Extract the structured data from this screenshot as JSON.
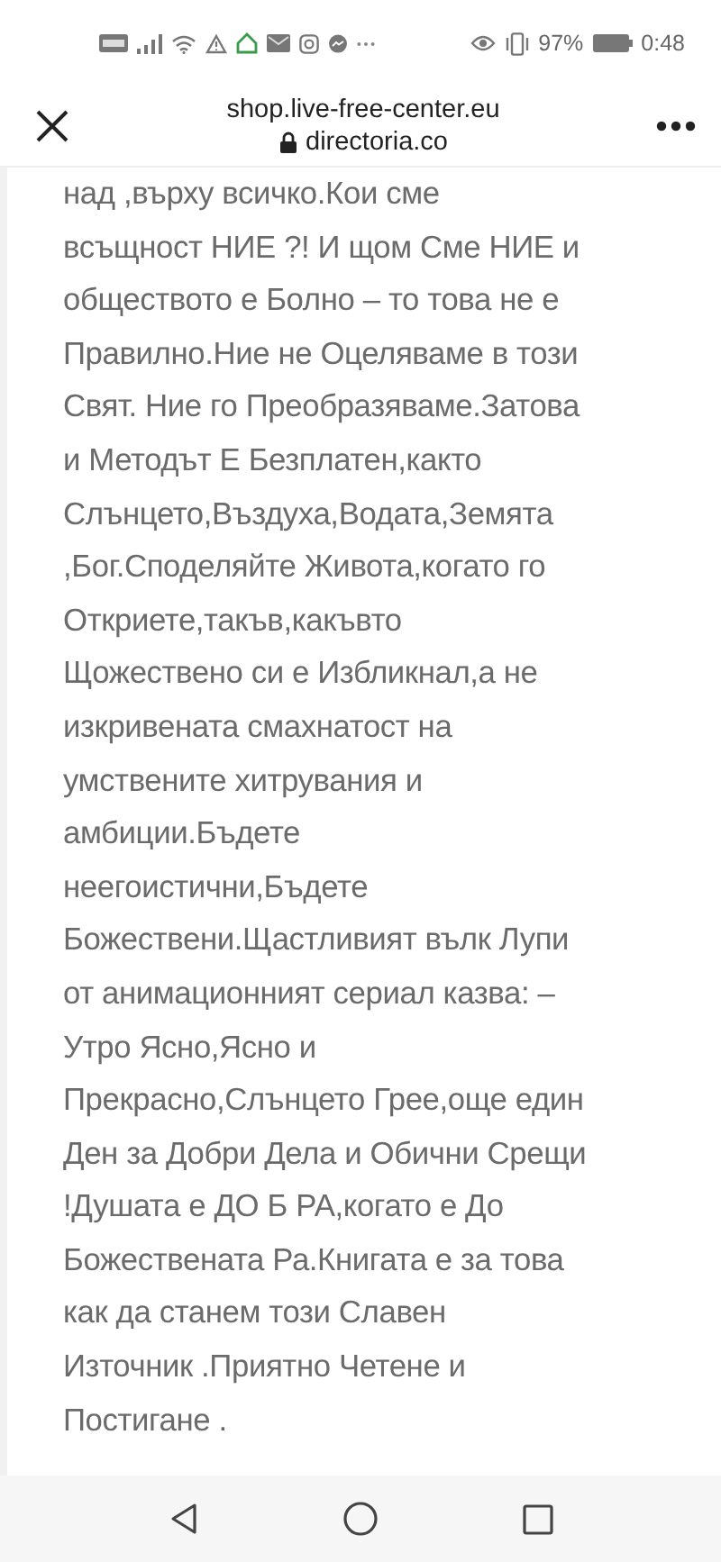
{
  "status_bar": {
    "battery_percent": "97%",
    "time": "0:48"
  },
  "header": {
    "title": "shop.live-free-center.eu",
    "subtitle": "directoria.co"
  },
  "article": {
    "lines": [
      "над ,върху всичко.Кои сме",
      "всъщност НИЕ ?! И щом Сме НИЕ и",
      "обществото е Болно – то това не е",
      "Правилно.Ние не Оцеляваме в този",
      "Свят. Ние го Преобразяваме.Затова",
      "и Методът Е Безплатен,както",
      "Слънцето,Въздуха,Водата,Земята",
      ",Бог.Споделяйте Живота,когато го",
      "Откриете,такъв,какъвто",
      "Щожествено си е Избликнал,а не",
      "изкривената смахнатост на",
      "умствените хитрувания и",
      "амбиции.Бъдете",
      "неегоистични,Бъдете",
      "Божествени.Щастливият вълк Лупи",
      "от анимационният сериал казва: –",
      "Утро Ясно,Ясно и",
      "Прекрасно,Слънцето Грее,още един",
      "Ден за Добри Дела и Обични Срещи",
      "!Душата е ДО Б РА,когато е До",
      "Божествената Ра.Книгата е за това",
      "как да станем този Славен",
      "Източник .Приятно Четене и",
      "Постигане ."
    ]
  }
}
